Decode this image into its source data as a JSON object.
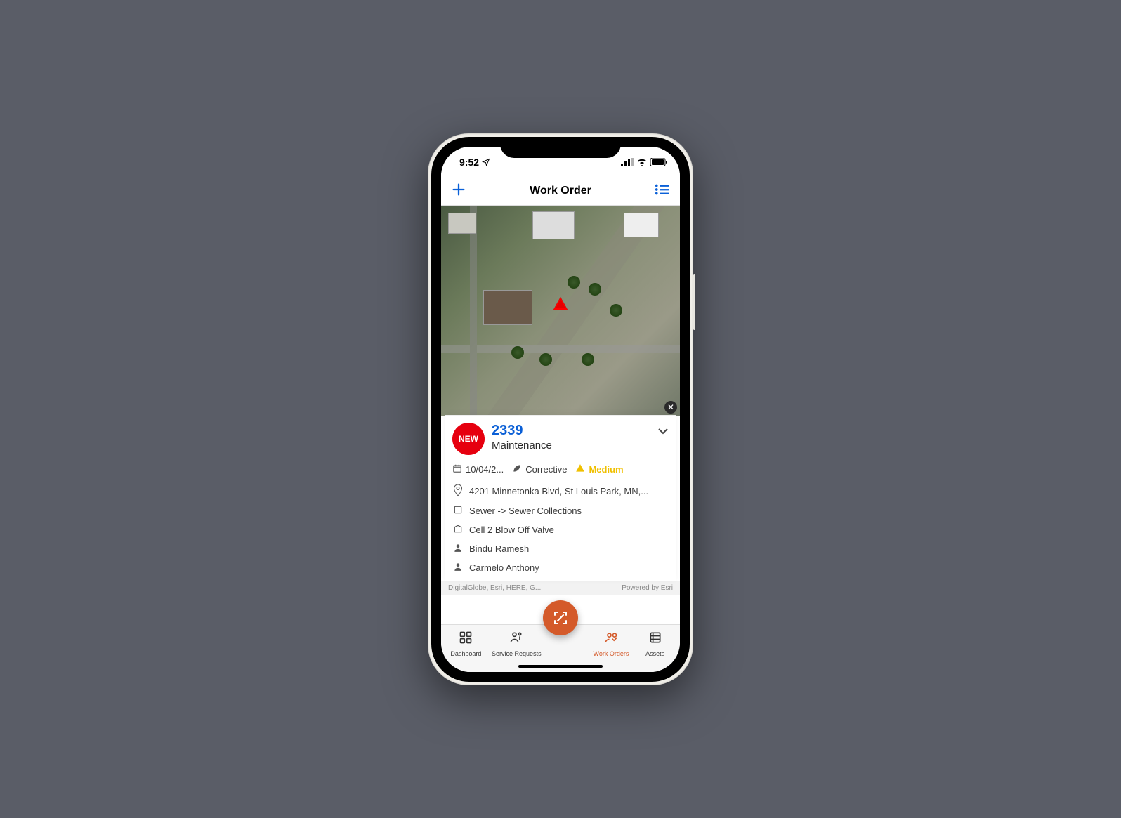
{
  "status": {
    "time": "9:52",
    "location_arrow": "➶"
  },
  "header": {
    "title": "Work Order"
  },
  "card": {
    "badge": "NEW",
    "id": "2339",
    "category": "Maintenance",
    "date": "10/04/2...",
    "type": "Corrective",
    "priority": "Medium",
    "address": "4201 Minnetonka Blvd, St Louis Park, MN,...",
    "path": "Sewer -> Sewer Collections",
    "asset": "Cell 2 Blow Off Valve",
    "person1": "Bindu Ramesh",
    "person2": "Carmelo Anthony"
  },
  "attribution": {
    "left": "DigitalGlobe, Esri, HERE, G...",
    "right": "Powered by Esri"
  },
  "nav": {
    "dashboard": "Dashboard",
    "service": "Service Requests",
    "workorders": "Work Orders",
    "assets": "Assets"
  }
}
